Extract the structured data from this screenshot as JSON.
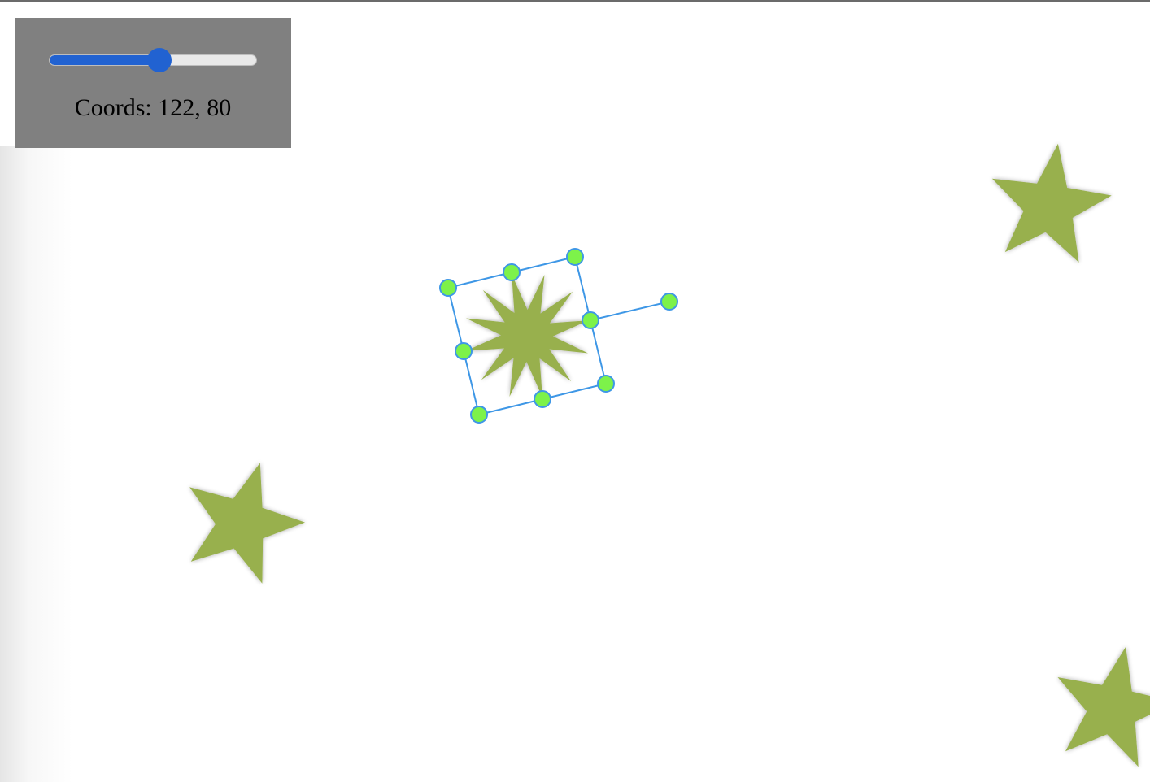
{
  "slider": {
    "value_fraction": 0.53
  },
  "coords": {
    "text": "Coords: 122, 80"
  },
  "colors": {
    "star": "#98b04e",
    "handle": "#7df24a",
    "handle_stroke": "#3e97e6",
    "selection": "#3e97e6",
    "panel": "#808080",
    "slider_active": "#2162d1"
  },
  "shapes": [
    {
      "kind": "five-point-star",
      "selected": false
    },
    {
      "kind": "five-point-star",
      "selected": false
    },
    {
      "kind": "five-point-star",
      "selected": false
    },
    {
      "kind": "twelve-point-star",
      "selected": true
    }
  ]
}
